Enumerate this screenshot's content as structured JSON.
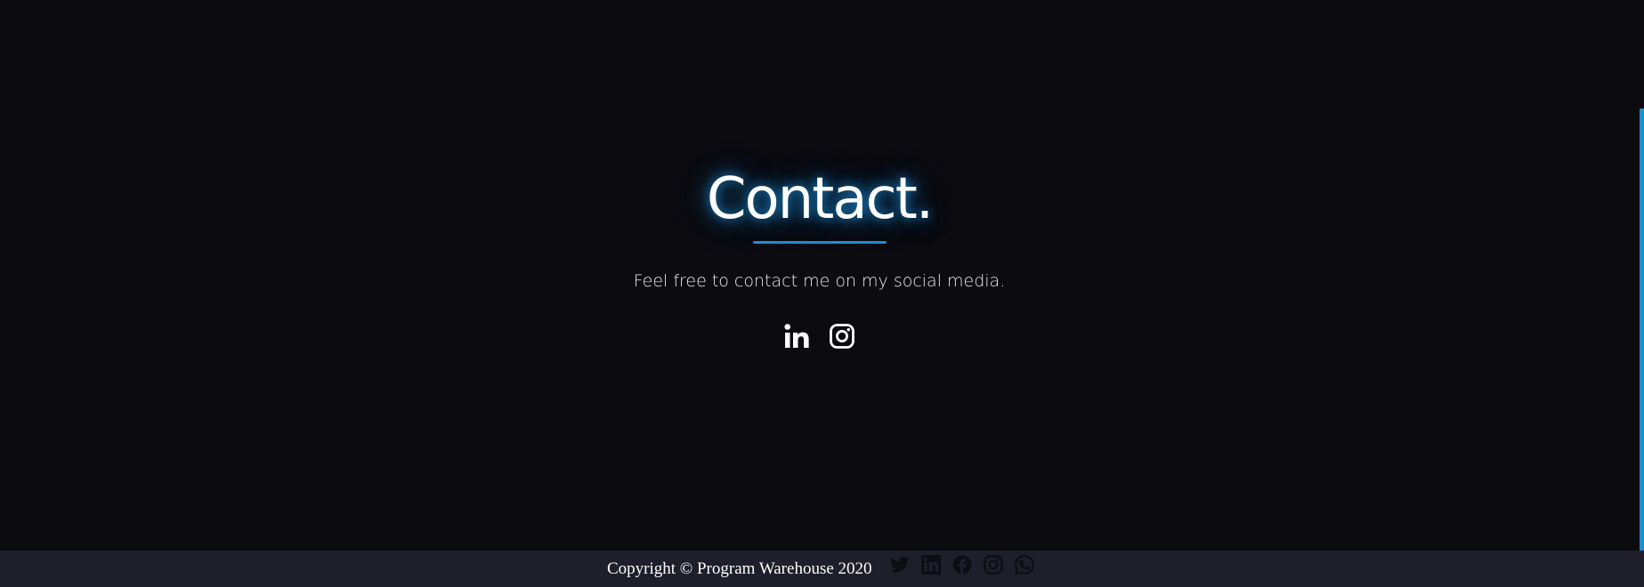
{
  "contact": {
    "title": "Contact.",
    "subtitle": "Feel free to contact me on my social media.",
    "social_links": [
      {
        "icon": "linkedin-icon"
      },
      {
        "icon": "instagram-icon"
      }
    ]
  },
  "footer": {
    "copyright": "Copyright © Program Warehouse 2020",
    "icons": [
      "twitter-icon",
      "linkedin-icon",
      "facebook-icon",
      "instagram-icon",
      "whatsapp-icon"
    ]
  },
  "colors": {
    "background": "#0b0b10",
    "accent": "#1b8fd2",
    "footer_background": "#1e1f2b",
    "footer_icon": "#0d0e14",
    "text": "#ffffff"
  }
}
